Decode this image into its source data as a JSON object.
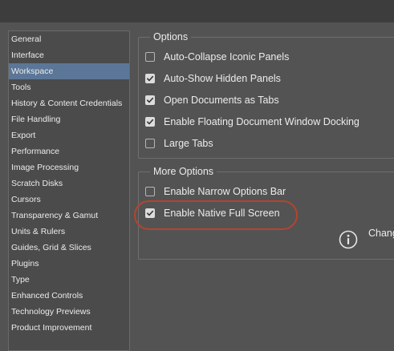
{
  "sidebar": {
    "items": [
      {
        "label": "General"
      },
      {
        "label": "Interface"
      },
      {
        "label": "Workspace",
        "selected": true
      },
      {
        "label": "Tools"
      },
      {
        "label": "History & Content Credentials"
      },
      {
        "label": "File Handling"
      },
      {
        "label": "Export"
      },
      {
        "label": "Performance"
      },
      {
        "label": "Image Processing"
      },
      {
        "label": "Scratch Disks"
      },
      {
        "label": "Cursors"
      },
      {
        "label": "Transparency & Gamut"
      },
      {
        "label": "Units & Rulers"
      },
      {
        "label": "Guides, Grid & Slices"
      },
      {
        "label": "Plugins"
      },
      {
        "label": "Type"
      },
      {
        "label": "Enhanced Controls"
      },
      {
        "label": "Technology Previews"
      },
      {
        "label": "Product Improvement"
      }
    ]
  },
  "options": {
    "title": "Options",
    "items": [
      {
        "label": "Auto-Collapse Iconic Panels",
        "checked": false
      },
      {
        "label": "Auto-Show Hidden Panels",
        "checked": true
      },
      {
        "label": "Open Documents as Tabs",
        "checked": true
      },
      {
        "label": "Enable Floating Document Window Docking",
        "checked": true
      },
      {
        "label": "Large Tabs",
        "checked": false
      }
    ]
  },
  "more_options": {
    "title": "More Options",
    "items": [
      {
        "label": "Enable Narrow Options Bar",
        "checked": false
      },
      {
        "label": "Enable Native Full Screen",
        "checked": true
      }
    ],
    "info_text": "Chang"
  },
  "colors": {
    "selection": "#5b7697",
    "highlight": "#b5442f"
  }
}
